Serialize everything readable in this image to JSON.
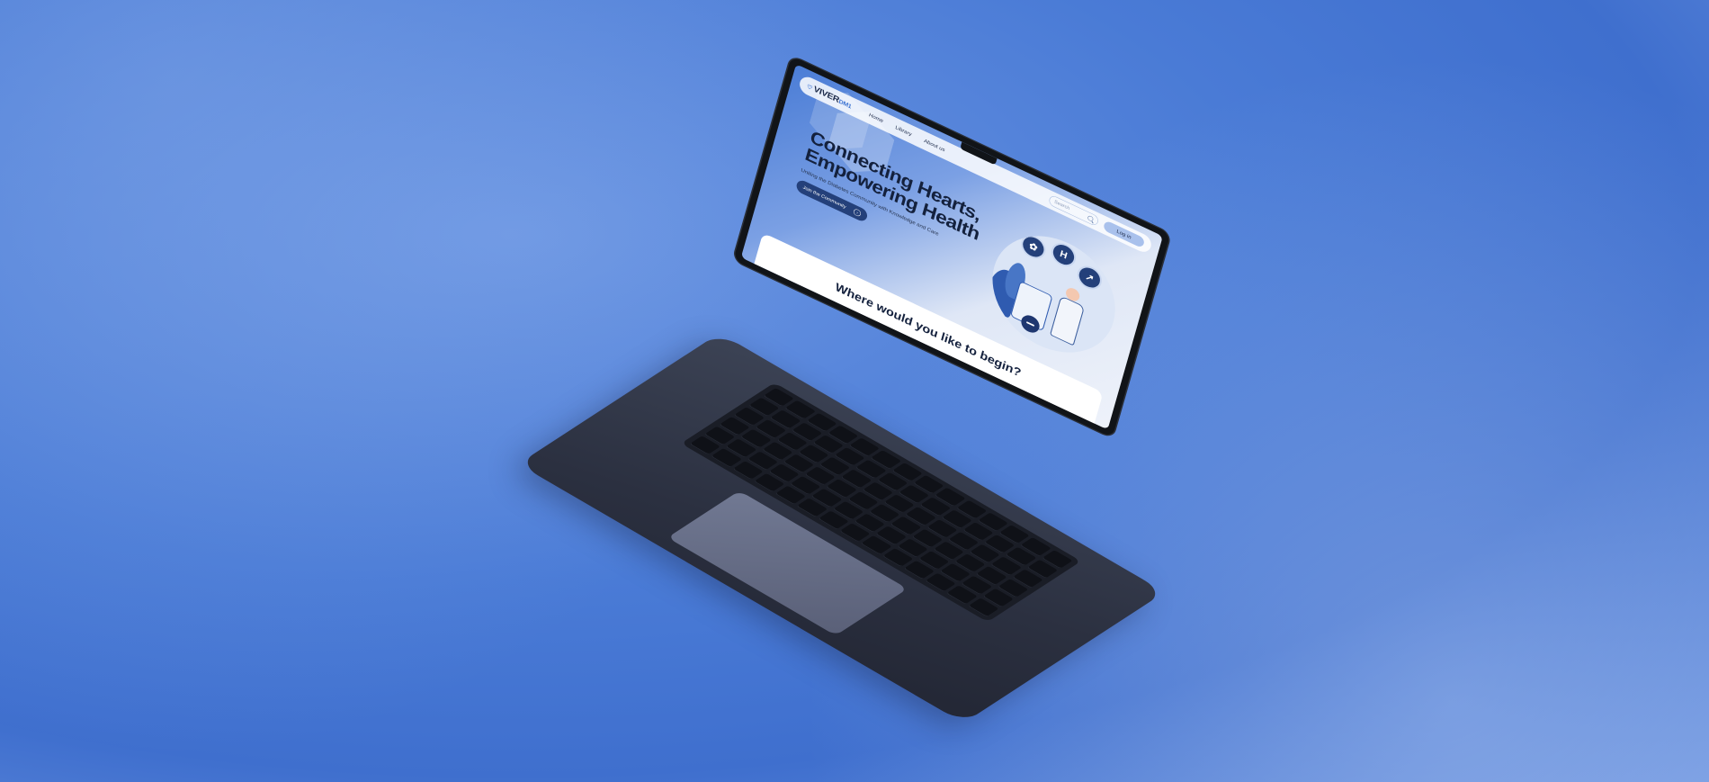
{
  "logo": {
    "name": "VIVER",
    "suffix": "DM1"
  },
  "nav": {
    "links": [
      "Home",
      "Library",
      "About us"
    ],
    "search_placeholder": "Search",
    "login_label": "Log in"
  },
  "hero": {
    "title_line1": "Connecting Hearts,",
    "title_line2": "Empowering Health",
    "subtitle": "Uniting the Diabetes Community with Knowledge and Care",
    "cta_label": "Join the Community"
  },
  "section": {
    "heading": "Where would you like to begin?"
  },
  "colors": {
    "accent": "#24407a",
    "brand_light": "#a9c1ec",
    "background": "#4a7bd6"
  },
  "icons": [
    "heart-icon",
    "search-icon",
    "arrow-right-icon",
    "medical-badge-icon",
    "minus-icon"
  ]
}
